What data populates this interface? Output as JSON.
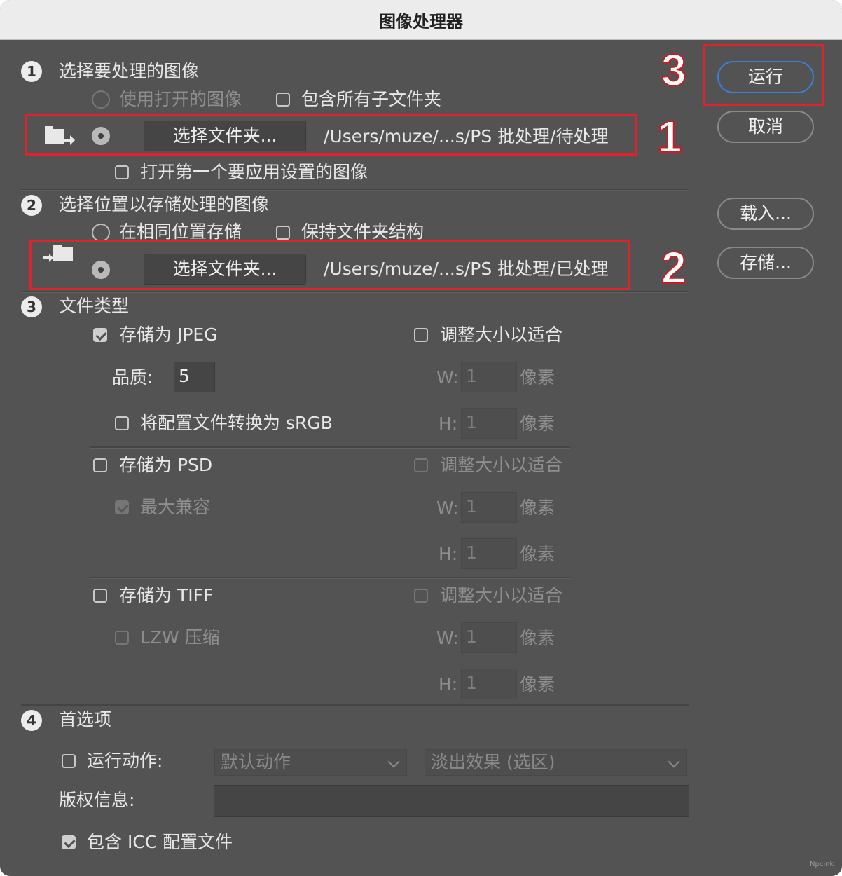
{
  "window": {
    "title": "图像处理器"
  },
  "sections": {
    "s1": {
      "number": "1",
      "title": "选择要处理的图像",
      "use_open_images": "使用打开的图像",
      "include_subfolders": "包含所有子文件夹",
      "select_folder_button": "选择文件夹...",
      "source_path": "/Users/muze/...s/PS 批处理/待处理",
      "open_first_image": "打开第一个要应用设置的图像"
    },
    "s2": {
      "number": "2",
      "title": "选择位置以存储处理的图像",
      "save_same_location": "在相同位置存储",
      "keep_folder_structure": "保持文件夹结构",
      "select_folder_button": "选择文件夹...",
      "dest_path": "/Users/muze/...s/PS 批处理/已处理"
    },
    "s3": {
      "number": "3",
      "title": "文件类型",
      "jpeg": {
        "save_as": "存储为 JPEG",
        "resize_to_fit": "调整大小以适合",
        "quality_label": "品质:",
        "quality_value": "5",
        "w_label": "W:",
        "w_value": "1",
        "h_label": "H:",
        "h_value": "1",
        "unit": "像素",
        "convert_srgb": "将配置文件转换为 sRGB"
      },
      "psd": {
        "save_as": "存储为 PSD",
        "resize_to_fit": "调整大小以适合",
        "max_compat": "最大兼容",
        "w_label": "W:",
        "w_value": "1",
        "h_label": "H:",
        "h_value": "1",
        "unit": "像素"
      },
      "tiff": {
        "save_as": "存储为 TIFF",
        "resize_to_fit": "调整大小以适合",
        "lzw": "LZW 压缩",
        "w_label": "W:",
        "w_value": "1",
        "h_label": "H:",
        "h_value": "1",
        "unit": "像素"
      }
    },
    "s4": {
      "number": "4",
      "title": "首选项",
      "run_action": "运行动作:",
      "action_set": "默认动作",
      "action": "淡出效果 (选区)",
      "copyright_label": "版权信息:",
      "copyright_value": "",
      "include_icc": "包含 ICC 配置文件"
    }
  },
  "buttons": {
    "run": "运行",
    "cancel": "取消",
    "load": "载入...",
    "save": "存储..."
  },
  "annotations": {
    "a1": "1",
    "a2": "2",
    "a3": "3"
  },
  "watermark": "Npcink",
  "colors": {
    "highlight_box": "#e0222a",
    "primary_button_border": "#3a7fd8",
    "dialog_bg": "#535353"
  }
}
